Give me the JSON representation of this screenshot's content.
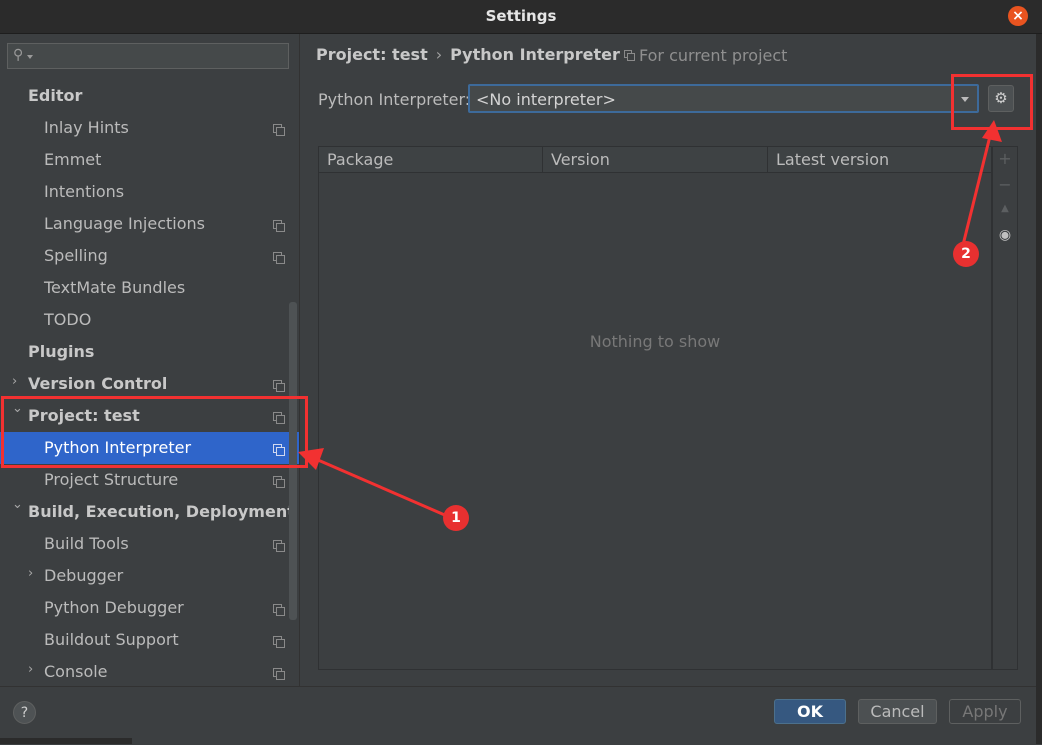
{
  "window": {
    "title": "Settings"
  },
  "sidebar": {
    "search": {
      "placeholder": "",
      "value": ""
    },
    "items": [
      {
        "label": "Editor",
        "level": 0,
        "bold": true,
        "arrow": "",
        "copy": false
      },
      {
        "label": "Inlay Hints",
        "level": 1,
        "bold": false,
        "arrow": "",
        "copy": true
      },
      {
        "label": "Emmet",
        "level": 1,
        "bold": false,
        "arrow": "",
        "copy": false
      },
      {
        "label": "Intentions",
        "level": 1,
        "bold": false,
        "arrow": "",
        "copy": false
      },
      {
        "label": "Language Injections",
        "level": 1,
        "bold": false,
        "arrow": "",
        "copy": true
      },
      {
        "label": "Spelling",
        "level": 1,
        "bold": false,
        "arrow": "",
        "copy": true
      },
      {
        "label": "TextMate Bundles",
        "level": 1,
        "bold": false,
        "arrow": "",
        "copy": false
      },
      {
        "label": "TODO",
        "level": 1,
        "bold": false,
        "arrow": "",
        "copy": false
      },
      {
        "label": "Plugins",
        "level": 0,
        "bold": true,
        "arrow": "",
        "copy": false
      },
      {
        "label": "Version Control",
        "level": 0,
        "bold": true,
        "arrow": "collapsed",
        "copy": true
      },
      {
        "label": "Project: test",
        "level": 0,
        "bold": true,
        "arrow": "expanded",
        "copy": true
      },
      {
        "label": "Python Interpreter",
        "level": 1,
        "bold": false,
        "arrow": "",
        "copy": true,
        "selected": true
      },
      {
        "label": "Project Structure",
        "level": 1,
        "bold": false,
        "arrow": "",
        "copy": true
      },
      {
        "label": "Build, Execution, Deployment",
        "level": 0,
        "bold": true,
        "arrow": "expanded",
        "copy": false
      },
      {
        "label": "Build Tools",
        "level": 1,
        "bold": false,
        "arrow": "",
        "copy": true
      },
      {
        "label": "Debugger",
        "level": 1,
        "bold": false,
        "arrow": "collapsed",
        "copy": false
      },
      {
        "label": "Python Debugger",
        "level": 1,
        "bold": false,
        "arrow": "",
        "copy": true
      },
      {
        "label": "Buildout Support",
        "level": 1,
        "bold": false,
        "arrow": "",
        "copy": true
      },
      {
        "label": "Console",
        "level": 1,
        "bold": false,
        "arrow": "collapsed",
        "copy": true
      }
    ]
  },
  "breadcrumb": {
    "project": "Project: test",
    "separator": "›",
    "page": "Python Interpreter"
  },
  "scope_note": "For current project",
  "interpreter": {
    "label": "Python Interpreter:",
    "value": "<No interpreter>"
  },
  "packages_table": {
    "columns": [
      "Package",
      "Version",
      "Latest version"
    ],
    "rows": [],
    "empty_text": "Nothing to show",
    "tools": [
      {
        "name": "add-icon",
        "glyph": "+"
      },
      {
        "name": "remove-icon",
        "glyph": "−"
      },
      {
        "name": "upgrade-icon",
        "glyph": "▲"
      },
      {
        "name": "eye-icon",
        "glyph": "👁"
      }
    ]
  },
  "buttons": {
    "help": "?",
    "ok": "OK",
    "cancel": "Cancel",
    "apply": "Apply"
  },
  "annotations": [
    {
      "number": "1",
      "target": "Python Interpreter sidebar item"
    },
    {
      "number": "2",
      "target": "gear button"
    }
  ],
  "colors": {
    "selection": "#2f65ca",
    "annotation": "#f23131",
    "ok_button": "#365880",
    "close_button": "#e95420"
  }
}
